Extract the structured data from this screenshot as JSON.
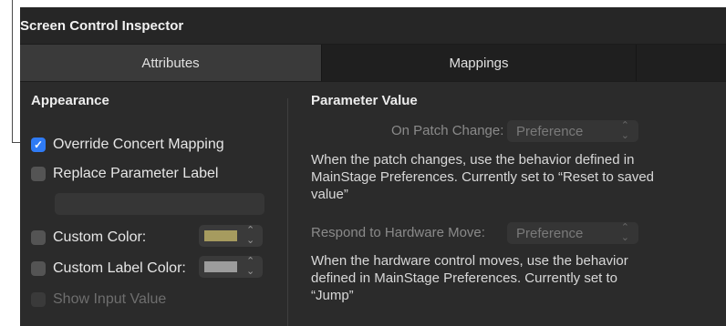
{
  "inspector": {
    "title": "Screen Control Inspector"
  },
  "tabs": [
    {
      "label": "Attributes",
      "active": true
    },
    {
      "label": "Mappings",
      "active": false
    }
  ],
  "appearance": {
    "heading": "Appearance",
    "override_concert_mapping": {
      "label": "Override Concert Mapping",
      "checked": true
    },
    "replace_parameter_label": {
      "label": "Replace Parameter Label",
      "checked": false,
      "value": ""
    },
    "custom_color": {
      "label": "Custom Color:",
      "checked": false,
      "swatch": "#a69b5f"
    },
    "custom_label_color": {
      "label": "Custom Label Color:",
      "checked": false,
      "swatch": "#9c9c9c"
    },
    "show_input_value": {
      "label": "Show Input Value",
      "checked": false,
      "enabled": false
    }
  },
  "parameter_value": {
    "heading": "Parameter Value",
    "on_patch_change": {
      "label": "On Patch Change:",
      "value": "Preference",
      "description": "When the patch changes, use the behavior defined in MainStage Preferences. Currently set to “Reset to saved value”"
    },
    "respond_to_hardware_move": {
      "label": "Respond to Hardware Move:",
      "value": "Preference",
      "description": "When the hardware control moves, use the behavior defined in MainStage Preferences. Currently set to “Jump”"
    }
  },
  "colors": {
    "accent": "#2f7bf5",
    "panel": "#2b2b2b",
    "tab_active": "#3a3a3a"
  },
  "icons": {
    "checkmark": "checkmark-icon",
    "popup_chevron": "updown-chevron-icon"
  }
}
